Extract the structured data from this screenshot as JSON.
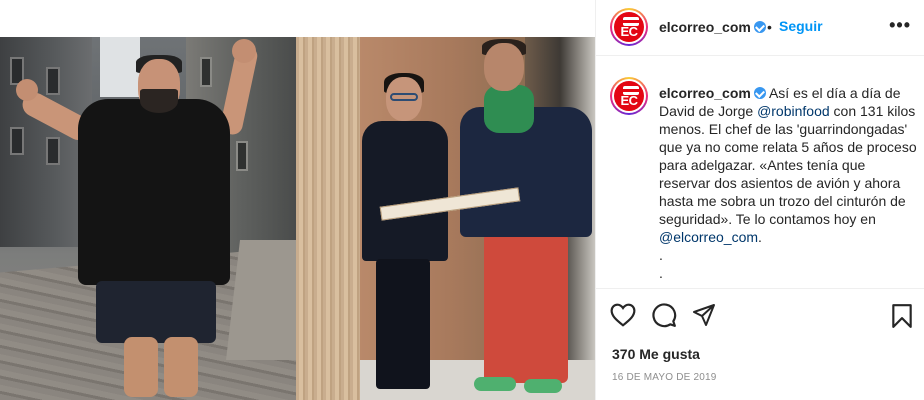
{
  "post": {
    "account": "elcorreo_com",
    "avatar_text": "EC",
    "header": {
      "separator": "•",
      "follow_label": "Seguir",
      "more_label": "•••"
    },
    "caption": {
      "username": "elcorreo_com",
      "part1": " Así es el día a día de David de Jorge ",
      "mention1": "@robinfood",
      "part2": " con 131 kilos menos. El chef de las 'guarrindongadas' que ya no come relata 5 años de proceso para adelgazar. «Antes tenía que reservar dos asientos de avión y ahora hasta me sobra un trozo del cinturón de seguridad». Te lo contamos hoy en ",
      "mention2": "@elcorreo_com",
      "part3": ".",
      "dot1": ".",
      "dot2": "."
    },
    "likes": "370 Me gusta",
    "date": "16 DE MAYO DE 2019"
  },
  "icons": {
    "verified": "verified-badge-icon",
    "like": "heart-icon",
    "comment": "comment-icon",
    "share": "send-icon",
    "save": "bookmark-icon",
    "more": "more-options-icon"
  },
  "colors": {
    "link_blue": "#0095f6",
    "mention": "#00376b",
    "verified": "#3897f0",
    "brand_red": "#e30613",
    "meta_gray": "#8e8e8e"
  }
}
